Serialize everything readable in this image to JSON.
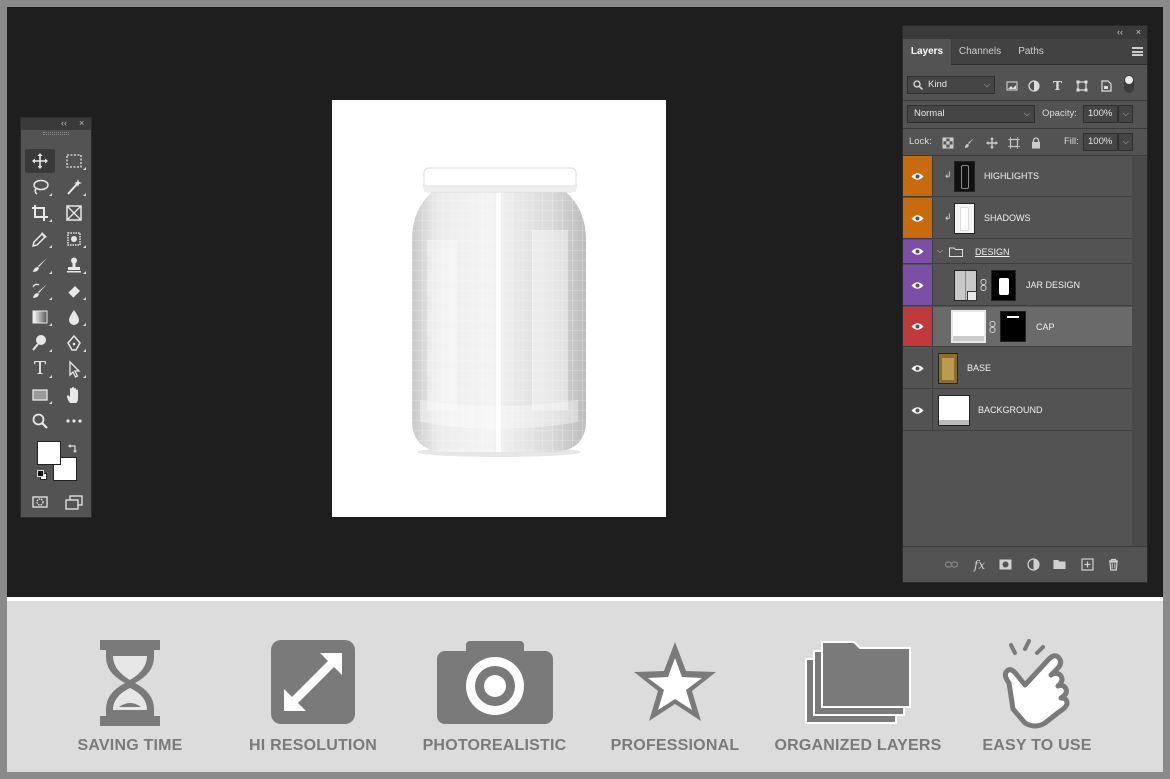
{
  "tools_panel": {
    "collapse_glyph": "‹‹",
    "close_glyph": "×",
    "tools": [
      "move-icon",
      "rect-marquee-icon",
      "lasso-icon",
      "magic-wand-icon",
      "crop-icon",
      "frame-icon",
      "eyedropper-icon",
      "healing-icon",
      "brush-icon",
      "stamp-icon",
      "history-brush-icon",
      "eraser-icon",
      "gradient-icon",
      "blur-icon",
      "dodge-icon",
      "pen-icon",
      "type-icon",
      "path-select-icon",
      "rectangle-icon",
      "hand-icon",
      "zoom-icon",
      "more-icon"
    ],
    "type_tool_glyph": "T"
  },
  "layers_panel": {
    "collapse_glyph": "‹‹",
    "close_glyph": "×",
    "tabs": [
      "Layers",
      "Channels",
      "Paths"
    ],
    "filter_kind": "Kind",
    "blend_mode": "Normal",
    "opacity_label": "Opacity:",
    "opacity_value": "100%",
    "lock_label": "Lock:",
    "fill_label": "Fill:",
    "fill_value": "100%",
    "dropdown_glyph": "⌵",
    "fx_glyph": "fx",
    "layers": [
      {
        "name": "HIGHLIGHTS",
        "tag_color": "#c76b0e"
      },
      {
        "name": "SHADOWS",
        "tag_color": "#c76b0e"
      },
      {
        "name": "DESIGN",
        "tag_color": "#7b4fa6"
      },
      {
        "name": "JAR DESIGN",
        "tag_color": "#7b4fa6"
      },
      {
        "name": "CAP",
        "tag_color": "#c0393b"
      },
      {
        "name": "BASE",
        "tag_color": ""
      },
      {
        "name": "BACKGROUND",
        "tag_color": ""
      }
    ]
  },
  "features": [
    {
      "label": "SAVING TIME",
      "icon": "hourglass-icon"
    },
    {
      "label": "HI RESOLUTION",
      "icon": "expand-arrows-icon"
    },
    {
      "label": "PHOTOREALISTIC",
      "icon": "camera-icon"
    },
    {
      "label": "PROFESSIONAL",
      "icon": "star-icon"
    },
    {
      "label": "ORGANIZED LAYERS",
      "icon": "folders-icon"
    },
    {
      "label": "EASY TO USE",
      "icon": "pointing-hand-icon"
    }
  ],
  "colors": {
    "workspace": "#1e1e1e",
    "panel": "#535353",
    "feature_gray": "#7a7a7a"
  }
}
